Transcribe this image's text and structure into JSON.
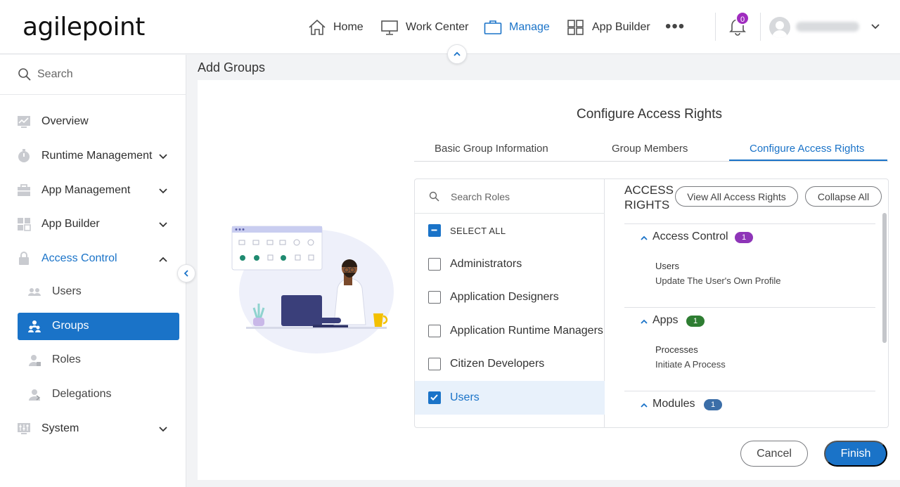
{
  "header": {
    "logo": "agilepoint",
    "nav": [
      {
        "label": "Home",
        "icon": "home-icon"
      },
      {
        "label": "Work Center",
        "icon": "monitor-icon"
      },
      {
        "label": "Manage",
        "icon": "briefcase-icon"
      },
      {
        "label": "App Builder",
        "icon": "grid-icon"
      }
    ],
    "more": "•••",
    "notifications_count": "0",
    "accent": "#1a73c8",
    "notif_color": "#a02cbf"
  },
  "sidebar": {
    "search_placeholder": "Search",
    "items": [
      {
        "label": "Overview",
        "icon": "chart-icon"
      },
      {
        "label": "Runtime Management",
        "icon": "timer-icon"
      },
      {
        "label": "App Management",
        "icon": "toolbox-icon"
      },
      {
        "label": "App Builder",
        "icon": "grid-icon"
      },
      {
        "label": "Access Control",
        "icon": "lock-icon"
      },
      {
        "label": "System",
        "icon": "sliders-icon"
      }
    ],
    "sub_items": [
      {
        "label": "Users",
        "icon": "users-icon"
      },
      {
        "label": "Groups",
        "icon": "groups-icon"
      },
      {
        "label": "Roles",
        "icon": "role-icon"
      },
      {
        "label": "Delegations",
        "icon": "delegation-icon"
      }
    ]
  },
  "main": {
    "page_title": "Add Groups",
    "config_title": "Configure Access Rights",
    "tabs": [
      {
        "label": "Basic Group Information"
      },
      {
        "label": "Group Members"
      },
      {
        "label": "Configure Access Rights"
      }
    ],
    "roles": {
      "search_placeholder": "Search Roles",
      "select_all": "SELECT ALL",
      "items": [
        {
          "label": "Administrators",
          "checked": false
        },
        {
          "label": "Application Designers",
          "checked": false
        },
        {
          "label": "Application Runtime Managers",
          "checked": false
        },
        {
          "label": "Citizen Developers",
          "checked": false
        },
        {
          "label": "Users",
          "checked": true
        }
      ]
    },
    "rights": {
      "heading": "ACCESS RIGHTS",
      "view_all": "View All Access Rights",
      "collapse_all": "Collapse All",
      "sections": [
        {
          "title": "Access Control",
          "count": "1",
          "color": "#8e35b8",
          "sub": "Users",
          "item": "Update The User's Own Profile"
        },
        {
          "title": "Apps",
          "count": "1",
          "color": "#2e7d32",
          "sub": "Processes",
          "item": "Initiate A Process"
        },
        {
          "title": "Modules",
          "count": "1",
          "color": "#3b6ea8"
        }
      ]
    },
    "cancel": "Cancel",
    "finish": "Finish"
  }
}
